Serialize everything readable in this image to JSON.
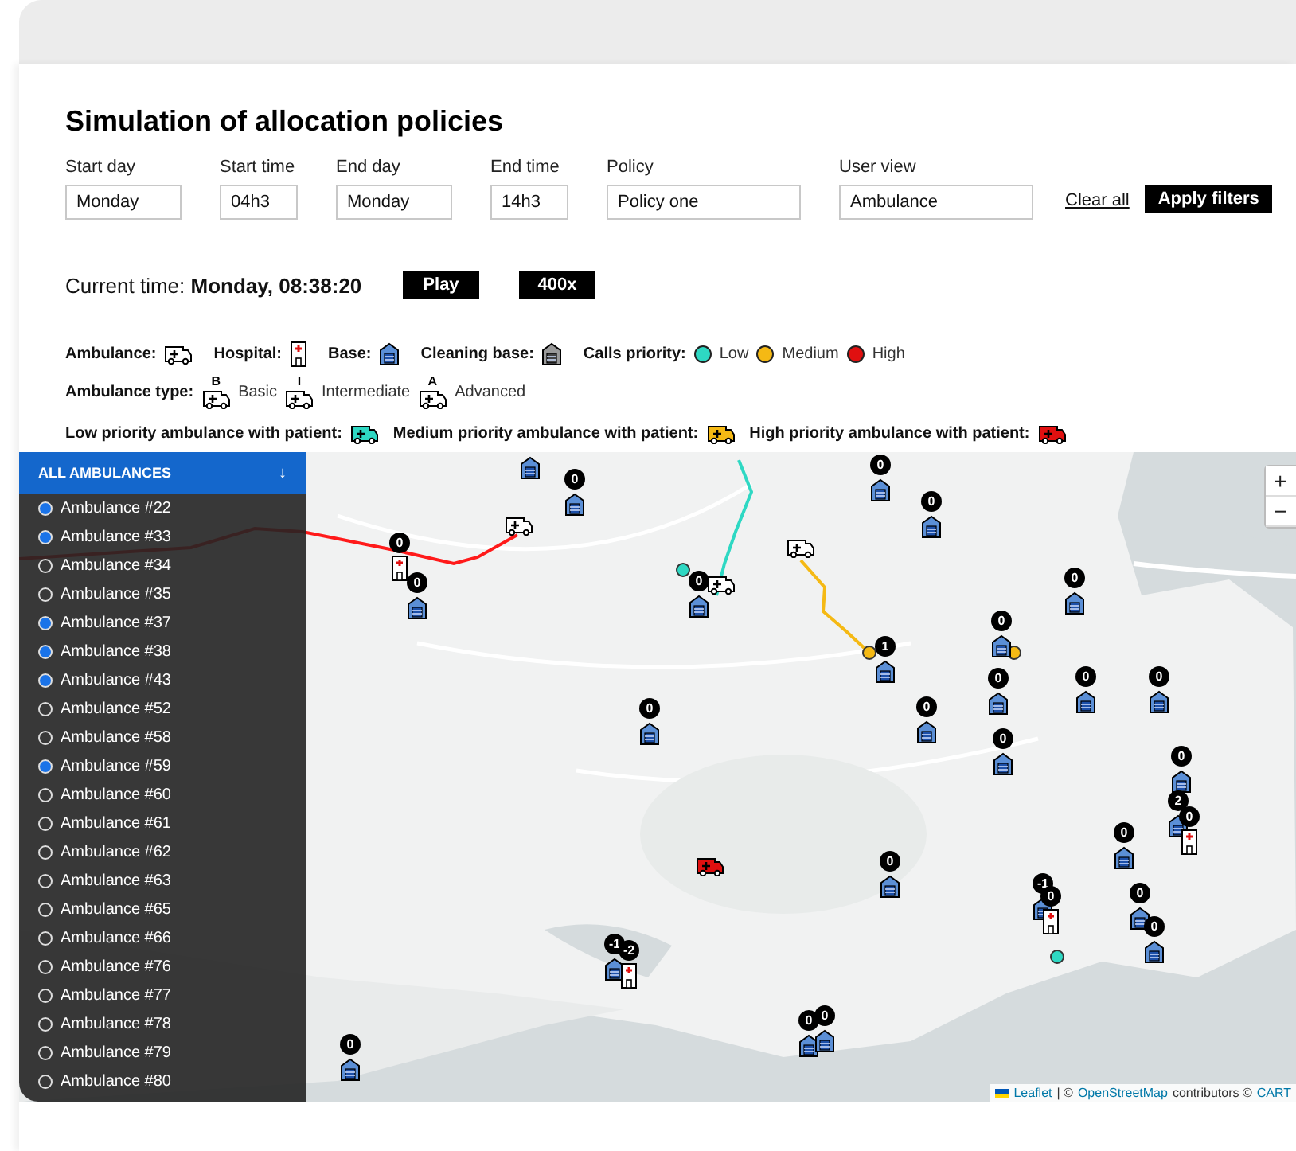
{
  "title": "Simulation of allocation policies",
  "filters": [
    {
      "label": "Start day",
      "value": "Monday"
    },
    {
      "label": "Start time",
      "value": "04h3"
    },
    {
      "label": "End day",
      "value": "Monday"
    },
    {
      "label": "End time",
      "value": "14h3"
    },
    {
      "label": "Policy",
      "value": "Policy one"
    },
    {
      "label": "User view",
      "value": "Ambulance"
    }
  ],
  "clear_all": "Clear all",
  "apply": "Apply filters",
  "current_time": "Current time: **Monday, 08:38:20**",
  "play": "Play",
  "speed": "400x",
  "legend": {
    "icons": [
      {
        "kind": "ambulance",
        "label": "Ambulance:"
      },
      {
        "kind": "hospital",
        "label": "Hospital:"
      },
      {
        "kind": "base",
        "label": "Base:"
      },
      {
        "kind": "cleaning",
        "label": "Cleaning base:"
      }
    ],
    "priority_label": "Calls priority:",
    "priorities": [
      {
        "label": "Low",
        "color": "#2ed8c3"
      },
      {
        "label": "Medium",
        "color": "#f5b914"
      },
      {
        "label": "High",
        "color": "#e01010"
      }
    ],
    "type_label": "Ambulance type:",
    "types": [
      {
        "letter": "B",
        "label": "Basic"
      },
      {
        "letter": "I",
        "label": "Intermediate"
      },
      {
        "letter": "A",
        "label": "Advanced"
      }
    ],
    "patient": [
      {
        "label": "Low priority ambulance with patient:",
        "color": "#2ed8c3"
      },
      {
        "label": "Medium priority ambulance with patient:",
        "color": "#f5b914"
      },
      {
        "label": "High priority ambulance with patient:",
        "color": "#e01010"
      }
    ]
  },
  "sidebar": {
    "header": "ALL AMBULANCES",
    "toggle": "↓",
    "items": [
      {
        "label": "Ambulance #22",
        "checked": true
      },
      {
        "label": "Ambulance #33",
        "checked": true
      },
      {
        "label": "Ambulance #34",
        "checked": false
      },
      {
        "label": "Ambulance #35",
        "checked": false
      },
      {
        "label": "Ambulance #37",
        "checked": true
      },
      {
        "label": "Ambulance #38",
        "checked": true
      },
      {
        "label": "Ambulance #43",
        "checked": true
      },
      {
        "label": "Ambulance #52",
        "checked": false
      },
      {
        "label": "Ambulance #58",
        "checked": false
      },
      {
        "label": "Ambulance #59",
        "checked": true
      },
      {
        "label": "Ambulance #60",
        "checked": false
      },
      {
        "label": "Ambulance #61",
        "checked": false
      },
      {
        "label": "Ambulance #62",
        "checked": false
      },
      {
        "label": "Ambulance #63",
        "checked": false
      },
      {
        "label": "Ambulance #65",
        "checked": false
      },
      {
        "label": "Ambulance #66",
        "checked": false
      },
      {
        "label": "Ambulance #76",
        "checked": false
      },
      {
        "label": "Ambulance #77",
        "checked": false
      },
      {
        "label": "Ambulance #78",
        "checked": false
      },
      {
        "label": "Ambulance #79",
        "checked": false
      },
      {
        "label": "Ambulance #80",
        "checked": false
      }
    ]
  },
  "map": {
    "markers": [
      {
        "kind": "base"
      },
      {
        "kind": "base",
        "count": "0"
      },
      {
        "kind": "hospital",
        "count": "0"
      },
      {
        "kind": "base",
        "count": "0"
      },
      {
        "kind": "base",
        "count": "0"
      },
      {
        "kind": "base",
        "count": "-1"
      },
      {
        "kind": "hospital",
        "count": "-2"
      },
      {
        "kind": "base",
        "count": "0"
      },
      {
        "kind": "base",
        "count": "0"
      },
      {
        "kind": "base",
        "count": "0"
      },
      {
        "kind": "base",
        "count": "0"
      },
      {
        "kind": "base",
        "count": "0"
      },
      {
        "kind": "base",
        "count": "1"
      },
      {
        "kind": "base",
        "count": "0"
      },
      {
        "kind": "base",
        "count": "0"
      },
      {
        "kind": "base",
        "count": "0"
      },
      {
        "kind": "base",
        "count": "0"
      },
      {
        "kind": "base",
        "count": "0"
      },
      {
        "kind": "base",
        "count": "0"
      },
      {
        "kind": "base",
        "count": "0"
      },
      {
        "kind": "base",
        "count": "2"
      },
      {
        "kind": "hospital",
        "count": "0"
      },
      {
        "kind": "base",
        "count": "0"
      },
      {
        "kind": "base",
        "count": "0"
      },
      {
        "kind": "base",
        "count": "-1"
      },
      {
        "kind": "hospital",
        "count": "0"
      },
      {
        "kind": "base",
        "count": "0"
      },
      {
        "kind": "base",
        "count": "0"
      },
      {
        "kind": "base",
        "count": "0"
      },
      {
        "kind": "base",
        "count": "0"
      }
    ],
    "ambulances": [
      {
        "color": "#ffffff"
      },
      {
        "color": "#ffffff"
      },
      {
        "color": "#ffffff"
      },
      {
        "color": "#e01010"
      }
    ],
    "calls": [
      {
        "color": "#2ed8c3"
      },
      {
        "color": "#2ed8c3"
      },
      {
        "color": "#f5b914"
      },
      {
        "color": "#f5b914"
      }
    ],
    "routes": [
      {
        "color": "#ff1a1a"
      },
      {
        "color": "#2ed8c3"
      },
      {
        "color": "#f5b914"
      }
    ],
    "zoom": [
      "+",
      "−"
    ],
    "attribution": {
      "leaflet": "Leaflet",
      "sep": "| ©",
      "osm": "OpenStreetMap",
      "text": "contributors ©",
      "carto": "CART"
    }
  }
}
